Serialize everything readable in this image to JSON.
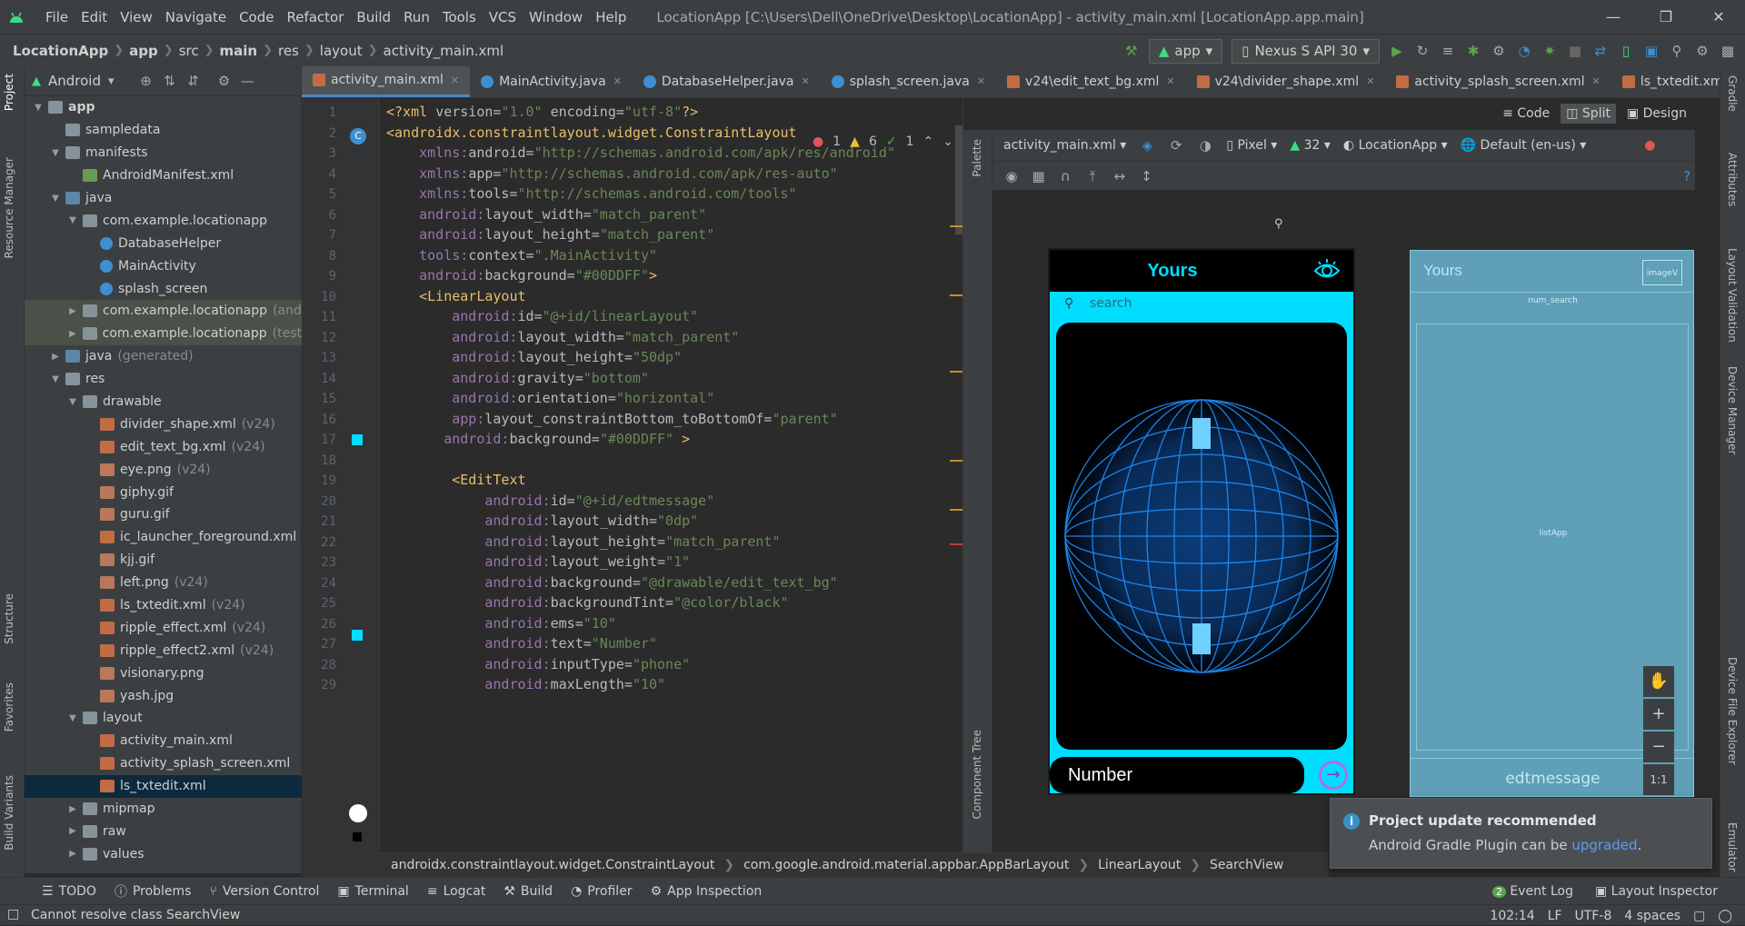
{
  "menubar": {
    "items": [
      "File",
      "Edit",
      "View",
      "Navigate",
      "Code",
      "Refactor",
      "Build",
      "Run",
      "Tools",
      "VCS",
      "Window",
      "Help"
    ],
    "window_title": "LocationApp [C:\\Users\\Dell\\OneDrive\\Desktop\\LocationApp] - activity_main.xml [LocationApp.app.main]"
  },
  "navbar": {
    "breadcrumbs": [
      "LocationApp",
      "app",
      "src",
      "main",
      "res",
      "layout",
      "activity_main.xml"
    ],
    "run_config": "app",
    "device": "Nexus S API 30"
  },
  "project": {
    "view": "Android",
    "tree": [
      {
        "label": "app",
        "suffix": "",
        "depth": 0,
        "arrow": "down",
        "icon": "folder"
      },
      {
        "label": "sampledata",
        "suffix": "",
        "depth": 1,
        "arrow": "",
        "icon": "folder"
      },
      {
        "label": "manifests",
        "suffix": "",
        "depth": 1,
        "arrow": "down",
        "icon": "folder"
      },
      {
        "label": "AndroidManifest.xml",
        "suffix": "",
        "depth": 2,
        "arrow": "",
        "icon": "manf"
      },
      {
        "label": "java",
        "suffix": "",
        "depth": 1,
        "arrow": "down",
        "icon": "folderj"
      },
      {
        "label": "com.example.locationapp",
        "suffix": "",
        "depth": 2,
        "arrow": "down",
        "icon": "folder"
      },
      {
        "label": "DatabaseHelper",
        "suffix": "",
        "depth": 3,
        "arrow": "",
        "icon": "cls"
      },
      {
        "label": "MainActivity",
        "suffix": "",
        "depth": 3,
        "arrow": "",
        "icon": "cls"
      },
      {
        "label": "splash_screen",
        "suffix": "",
        "depth": 3,
        "arrow": "",
        "icon": "cls"
      },
      {
        "label": "com.example.locationapp",
        "suffix": "(and",
        "depth": 2,
        "arrow": "right",
        "icon": "folder",
        "hl": true
      },
      {
        "label": "com.example.locationapp",
        "suffix": "(test",
        "depth": 2,
        "arrow": "right",
        "icon": "folder",
        "hl": true
      },
      {
        "label": "java",
        "suffix": "(generated)",
        "depth": 1,
        "arrow": "right",
        "icon": "folderj"
      },
      {
        "label": "res",
        "suffix": "",
        "depth": 1,
        "arrow": "down",
        "icon": "folder"
      },
      {
        "label": "drawable",
        "suffix": "",
        "depth": 2,
        "arrow": "down",
        "icon": "folder"
      },
      {
        "label": "divider_shape.xml",
        "suffix": "(v24)",
        "depth": 3,
        "arrow": "",
        "icon": "xmlf"
      },
      {
        "label": "edit_text_bg.xml",
        "suffix": "(v24)",
        "depth": 3,
        "arrow": "",
        "icon": "xmlf"
      },
      {
        "label": "eye.png",
        "suffix": "(v24)",
        "depth": 3,
        "arrow": "",
        "icon": "imgf"
      },
      {
        "label": "giphy.gif",
        "suffix": "",
        "depth": 3,
        "arrow": "",
        "icon": "imgf"
      },
      {
        "label": "guru.gif",
        "suffix": "",
        "depth": 3,
        "arrow": "",
        "icon": "imgf"
      },
      {
        "label": "ic_launcher_foreground.xml",
        "suffix": "",
        "depth": 3,
        "arrow": "",
        "icon": "xmlf"
      },
      {
        "label": "kjj.gif",
        "suffix": "",
        "depth": 3,
        "arrow": "",
        "icon": "imgf"
      },
      {
        "label": "left.png",
        "suffix": "(v24)",
        "depth": 3,
        "arrow": "",
        "icon": "imgf"
      },
      {
        "label": "ls_txtedit.xml",
        "suffix": "(v24)",
        "depth": 3,
        "arrow": "",
        "icon": "xmlf"
      },
      {
        "label": "ripple_effect.xml",
        "suffix": "(v24)",
        "depth": 3,
        "arrow": "",
        "icon": "xmlf"
      },
      {
        "label": "ripple_effect2.xml",
        "suffix": "(v24)",
        "depth": 3,
        "arrow": "",
        "icon": "xmlf"
      },
      {
        "label": "visionary.png",
        "suffix": "",
        "depth": 3,
        "arrow": "",
        "icon": "imgf"
      },
      {
        "label": "yash.jpg",
        "suffix": "",
        "depth": 3,
        "arrow": "",
        "icon": "imgf"
      },
      {
        "label": "layout",
        "suffix": "",
        "depth": 2,
        "arrow": "down",
        "icon": "folder"
      },
      {
        "label": "activity_main.xml",
        "suffix": "",
        "depth": 3,
        "arrow": "",
        "icon": "xmlf"
      },
      {
        "label": "activity_splash_screen.xml",
        "suffix": "",
        "depth": 3,
        "arrow": "",
        "icon": "xmlf"
      },
      {
        "label": "ls_txtedit.xml",
        "suffix": "",
        "depth": 3,
        "arrow": "",
        "icon": "xmlf",
        "sel": true
      },
      {
        "label": "mipmap",
        "suffix": "",
        "depth": 2,
        "arrow": "right",
        "icon": "folder"
      },
      {
        "label": "raw",
        "suffix": "",
        "depth": 2,
        "arrow": "right",
        "icon": "folder"
      },
      {
        "label": "values",
        "suffix": "",
        "depth": 2,
        "arrow": "right",
        "icon": "folder"
      }
    ]
  },
  "left_tabs": [
    "Project",
    "Resource Manager",
    "Structure",
    "Favorites",
    "Build Variants"
  ],
  "right_tabs": [
    "Gradle",
    "Attributes",
    "Layout Validation",
    "Device Manager",
    "Device File Explorer",
    "Emulator"
  ],
  "tabs": [
    {
      "label": "activity_main.xml",
      "icon": "xmlf",
      "active": true
    },
    {
      "label": "MainActivity.java",
      "icon": "cls"
    },
    {
      "label": "DatabaseHelper.java",
      "icon": "cls"
    },
    {
      "label": "splash_screen.java",
      "icon": "cls"
    },
    {
      "label": "v24\\edit_text_bg.xml",
      "icon": "xmlf"
    },
    {
      "label": "v24\\divider_shape.xml",
      "icon": "xmlf"
    },
    {
      "label": "activity_splash_screen.xml",
      "icon": "xmlf"
    },
    {
      "label": "ls_txtedit.xml",
      "icon": "xmlf"
    }
  ],
  "inspections": {
    "errors": "1",
    "warnings": "6",
    "weak": "1"
  },
  "code": [
    [
      [
        "tg",
        "<?xml "
      ],
      [
        "at",
        "version="
      ],
      [
        "st",
        "\"1.0\" "
      ],
      [
        "at",
        "encoding="
      ],
      [
        "st",
        "\"utf-8\""
      ],
      [
        "tg",
        "?>"
      ]
    ],
    [
      [
        "tg",
        "<androidx.constraintlayout.widget.ConstraintLayout"
      ]
    ],
    [
      [
        "pl",
        "    "
      ],
      [
        "ns",
        "xmlns:"
      ],
      [
        "at",
        "android="
      ],
      [
        "st",
        "\"http://schemas.android.com/apk/res/android\""
      ]
    ],
    [
      [
        "pl",
        "    "
      ],
      [
        "ns",
        "xmlns:"
      ],
      [
        "at",
        "app="
      ],
      [
        "st",
        "\"http://schemas.android.com/apk/res-auto\""
      ]
    ],
    [
      [
        "pl",
        "    "
      ],
      [
        "ns",
        "xmlns:"
      ],
      [
        "at",
        "tools="
      ],
      [
        "st",
        "\"http://schemas.android.com/tools\""
      ]
    ],
    [
      [
        "pl",
        "    "
      ],
      [
        "ns",
        "android:"
      ],
      [
        "at",
        "layout_width="
      ],
      [
        "st",
        "\"match_parent\""
      ]
    ],
    [
      [
        "pl",
        "    "
      ],
      [
        "ns",
        "android:"
      ],
      [
        "at",
        "layout_height="
      ],
      [
        "st",
        "\"match_parent\""
      ]
    ],
    [
      [
        "pl",
        "    "
      ],
      [
        "ns",
        "tools:"
      ],
      [
        "at",
        "context="
      ],
      [
        "st",
        "\".MainActivity\""
      ]
    ],
    [
      [
        "pl",
        "    "
      ],
      [
        "ns",
        "android:"
      ],
      [
        "at",
        "background="
      ],
      [
        "st",
        "\"#00DDFF\""
      ],
      [
        "tg",
        ">"
      ]
    ],
    [
      [
        "pl",
        "    "
      ],
      [
        "tg",
        "<LinearLayout"
      ]
    ],
    [
      [
        "pl",
        "        "
      ],
      [
        "ns",
        "android:"
      ],
      [
        "at",
        "id="
      ],
      [
        "st",
        "\"@+id/linearLayout\""
      ]
    ],
    [
      [
        "pl",
        "        "
      ],
      [
        "ns",
        "android:"
      ],
      [
        "at",
        "layout_width="
      ],
      [
        "st",
        "\"match_parent\""
      ]
    ],
    [
      [
        "pl",
        "        "
      ],
      [
        "ns",
        "android:"
      ],
      [
        "at",
        "layout_height="
      ],
      [
        "st",
        "\"50dp\""
      ]
    ],
    [
      [
        "pl",
        "        "
      ],
      [
        "ns",
        "android:"
      ],
      [
        "at",
        "gravity="
      ],
      [
        "st",
        "\"bottom\""
      ]
    ],
    [
      [
        "pl",
        "        "
      ],
      [
        "ns",
        "android:"
      ],
      [
        "at",
        "orientation="
      ],
      [
        "st",
        "\"horizontal\""
      ]
    ],
    [
      [
        "pl",
        "        "
      ],
      [
        "ns",
        "app:"
      ],
      [
        "at",
        "layout_constraintBottom_toBottomOf="
      ],
      [
        "st",
        "\"parent\""
      ]
    ],
    [
      [
        "pl",
        "       "
      ],
      [
        "ns",
        "android:"
      ],
      [
        "at",
        "background="
      ],
      [
        "st",
        "\"#00DDFF\" "
      ],
      [
        "tg",
        ">"
      ]
    ],
    [
      [
        "pl",
        ""
      ]
    ],
    [
      [
        "pl",
        "        "
      ],
      [
        "tg",
        "<EditText"
      ]
    ],
    [
      [
        "pl",
        "            "
      ],
      [
        "ns",
        "android:"
      ],
      [
        "at",
        "id="
      ],
      [
        "st",
        "\"@+id/edtmessage\""
      ]
    ],
    [
      [
        "pl",
        "            "
      ],
      [
        "ns",
        "android:"
      ],
      [
        "at",
        "layout_width="
      ],
      [
        "st",
        "\"0dp\""
      ]
    ],
    [
      [
        "pl",
        "            "
      ],
      [
        "ns",
        "android:"
      ],
      [
        "at",
        "layout_height="
      ],
      [
        "st",
        "\"match_parent\""
      ]
    ],
    [
      [
        "pl",
        "            "
      ],
      [
        "ns",
        "android:"
      ],
      [
        "at",
        "layout_weight="
      ],
      [
        "st",
        "\"1\""
      ]
    ],
    [
      [
        "pl",
        "            "
      ],
      [
        "ns",
        "android:"
      ],
      [
        "at",
        "background="
      ],
      [
        "st",
        "\"@drawable/edit_text_bg\""
      ]
    ],
    [
      [
        "pl",
        "            "
      ],
      [
        "ns",
        "android:"
      ],
      [
        "at",
        "backgroundTint="
      ],
      [
        "st",
        "\"@color/black\""
      ]
    ],
    [
      [
        "pl",
        "            "
      ],
      [
        "ns",
        "android:"
      ],
      [
        "at",
        "ems="
      ],
      [
        "st",
        "\"10\""
      ]
    ],
    [
      [
        "pl",
        "            "
      ],
      [
        "ns",
        "android:"
      ],
      [
        "at",
        "text="
      ],
      [
        "st",
        "\"Number\""
      ]
    ],
    [
      [
        "pl",
        "            "
      ],
      [
        "ns",
        "android:"
      ],
      [
        "at",
        "inputType="
      ],
      [
        "st",
        "\"phone\""
      ]
    ],
    [
      [
        "pl",
        "            "
      ],
      [
        "ns",
        "android:"
      ],
      [
        "at",
        "maxLength="
      ],
      [
        "st",
        "\"10\""
      ]
    ]
  ],
  "design": {
    "file": "activity_main.xml",
    "device": "Pixel",
    "api": "32",
    "theme": "LocationApp",
    "locale": "Default (en-us)",
    "view_modes": [
      "Code",
      "Split",
      "Design"
    ],
    "palette_label": "Palette",
    "component_tree_label": "Component Tree"
  },
  "phone": {
    "title": "Yours",
    "search_placeholder": "search",
    "edit_text": "Number"
  },
  "blueprint": {
    "title": "Yours",
    "search_label": "num_search",
    "list_label": "listApp",
    "edit_label": "edtmessage",
    "image_label": "imageV"
  },
  "zoom": {
    "fit": "1:1"
  },
  "code_breadcrumb": [
    "androidx.constraintlayout.widget.ConstraintLayout",
    "com.google.android.material.appbar.AppBarLayout",
    "LinearLayout",
    "SearchView"
  ],
  "notification": {
    "title": "Project update recommended",
    "body": "Android Gradle Plugin can be ",
    "link": "upgraded",
    "end": "."
  },
  "bottom_tools": [
    "TODO",
    "Problems",
    "Version Control",
    "Terminal",
    "Logcat",
    "Build",
    "Profiler",
    "App Inspection"
  ],
  "bottom_right": {
    "event_log_count": "2",
    "event_log": "Event Log",
    "layout_inspector": "Layout Inspector"
  },
  "status": {
    "message": "Cannot resolve class SearchView",
    "position": "102:14",
    "line_sep": "LF",
    "encoding": "UTF-8",
    "indent": "4 spaces"
  },
  "colors": {
    "accent": "#00DDFF",
    "ide_bg": "#2b2b2b",
    "panel": "#3c3f41",
    "selection": "#0d293e",
    "link": "#589df6"
  }
}
